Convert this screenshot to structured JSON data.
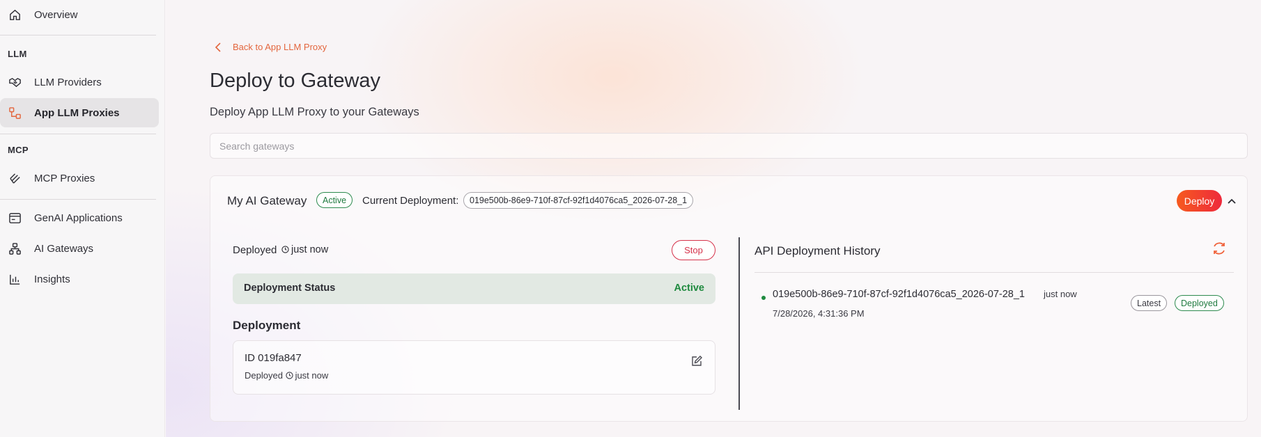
{
  "sidebar": {
    "items": [
      {
        "label": "Overview",
        "icon": "home-icon"
      },
      {
        "label": "LLM Providers",
        "icon": "handshake-icon"
      },
      {
        "label": "App LLM Proxies",
        "icon": "proxy-icon",
        "active": true
      },
      {
        "label": "MCP Proxies",
        "icon": "mcp-icon"
      },
      {
        "label": "GenAI Applications",
        "icon": "app-window-icon"
      },
      {
        "label": "AI Gateways",
        "icon": "network-icon"
      },
      {
        "label": "Insights",
        "icon": "bar-chart-icon"
      }
    ],
    "sections": {
      "llm": "LLM",
      "mcp": "MCP"
    }
  },
  "main": {
    "back_link": "Back to App LLM Proxy",
    "title": "Deploy to Gateway",
    "subtitle": "Deploy App LLM Proxy to your Gateways",
    "search_placeholder": "Search gateways"
  },
  "gateway": {
    "name": "My AI Gateway",
    "status": "Active",
    "current_deployment_label": "Current Deployment:",
    "current_deployment_id": "019e500b-86e9-710f-87cf-92f1d4076ca5_2026-07-28_1",
    "deploy_button": "Deploy",
    "deployed_label": "Deployed",
    "deployed_time": "just now",
    "stop_button": "Stop",
    "deployment_status_label": "Deployment Status",
    "deployment_status_value": "Active",
    "deployment_heading": "Deployment",
    "deployment_id": "ID 019fa847",
    "deployment_sub_label": "Deployed",
    "deployment_sub_time": "just now"
  },
  "history": {
    "title": "API Deployment History",
    "items": [
      {
        "id": "019e500b-86e9-710f-87cf-92f1d4076ca5_2026-07-28_1",
        "time": "just now",
        "date": "7/28/2026, 4:31:36 PM",
        "badges": [
          "Latest",
          "Deployed"
        ]
      }
    ]
  },
  "colors": {
    "accent": "#e3663e",
    "deploy_gradient_start": "#f65a1f",
    "deploy_gradient_end": "#ee2a3c",
    "success": "#1f8a3f",
    "danger": "#d6334b"
  }
}
